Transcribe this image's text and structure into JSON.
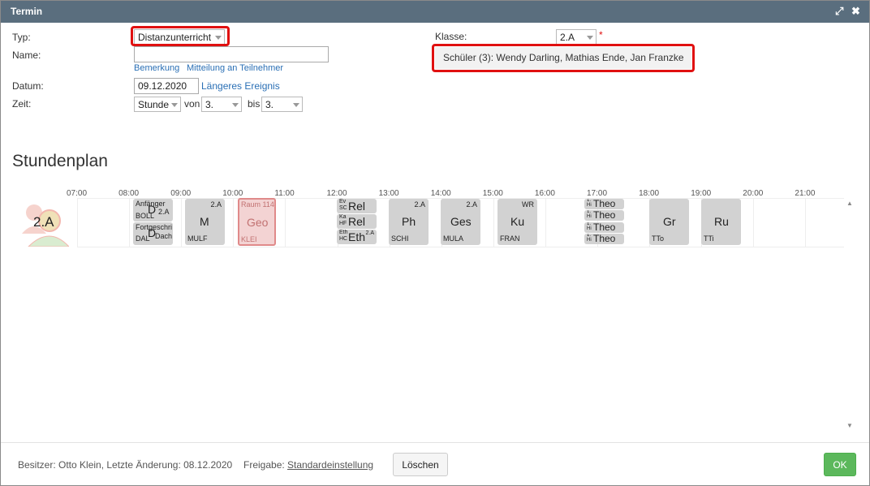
{
  "window": {
    "title": "Termin"
  },
  "form": {
    "typ_label": "Typ:",
    "typ_value": "Distanzunterricht",
    "name_label": "Name:",
    "name_value": "",
    "bemerkung_link": "Bemerkung",
    "mitteilung_link": "Mitteilung an Teilnehmer",
    "datum_label": "Datum:",
    "datum_value": "09.12.2020",
    "laengeres_link": "Längeres Ereignis",
    "zeit_label": "Zeit:",
    "zeit_unit": "Stunde",
    "von_label": "von",
    "von_value": "3.",
    "bis_label": "bis",
    "bis_value": "3.",
    "klasse_label": "Klasse:",
    "klasse_value": "2.A",
    "required_mark": "*",
    "schueler_text": "Schüler (3): Wendy Darling, Mathias Ende, Jan Franzke"
  },
  "stundenplan": {
    "heading": "Stundenplan",
    "class_name": "2.A",
    "times": [
      "07:00",
      "08:00",
      "09:00",
      "10:00",
      "11:00",
      "12:00",
      "13:00",
      "14:00",
      "15:00",
      "16:00",
      "17:00",
      "18:00",
      "19:00",
      "20:00",
      "21:00"
    ],
    "lessons": {
      "d1_tl": "Anfänger",
      "d1_big": "D",
      "d1_tr": "2.A",
      "d1_bl": "BOLL",
      "d2_tl": "Fortgeschri",
      "d2_big": "D",
      "d2_bl": "DAL",
      "d2_br": "Dach",
      "m_big": "M",
      "m_tr": "2.A",
      "m_bl": "MULF",
      "geo_big": "Geo",
      "geo_tr": "Raum 114",
      "geo_bl": "KLEI",
      "rel1_big": "Rel",
      "rel1_tl": "Ev",
      "rel1_bl": "SC",
      "rel2_big": "Rel",
      "rel2_tl": "Ka",
      "rel2_bl": "HF",
      "eth_big": "Eth",
      "eth_tl": "Eth",
      "eth_bl": "HC",
      "eth_br": "2.A",
      "ph_big": "Ph",
      "ph_tr": "2.A",
      "ph_bl": "SCHI",
      "ges_big": "Ges",
      "ges_tr": "2.A",
      "ges_bl": "MULA",
      "ku_big": "Ku",
      "ku_tr": "WR",
      "ku_bl": "FRAN",
      "theo_big": "Theo",
      "theo_tl": "1.",
      "theo_bl": "Hi",
      "gr_big": "Gr",
      "gr_bl": "TTo",
      "ru_big": "Ru",
      "ru_bl": "TTi"
    }
  },
  "footer": {
    "besitzer": "Besitzer: Otto Klein, Letzte Änderung: 08.12.2020",
    "freigabe_label": "Freigabe:",
    "freigabe_link": "Standardeinstellung",
    "loeschen": "Löschen",
    "ok": "OK"
  },
  "colors": {
    "titlebar": "#5a6e7e",
    "link": "#2a6fb5",
    "highlight": "#e01010",
    "ok": "#5cb85c",
    "cell": "#d2d2d2"
  }
}
